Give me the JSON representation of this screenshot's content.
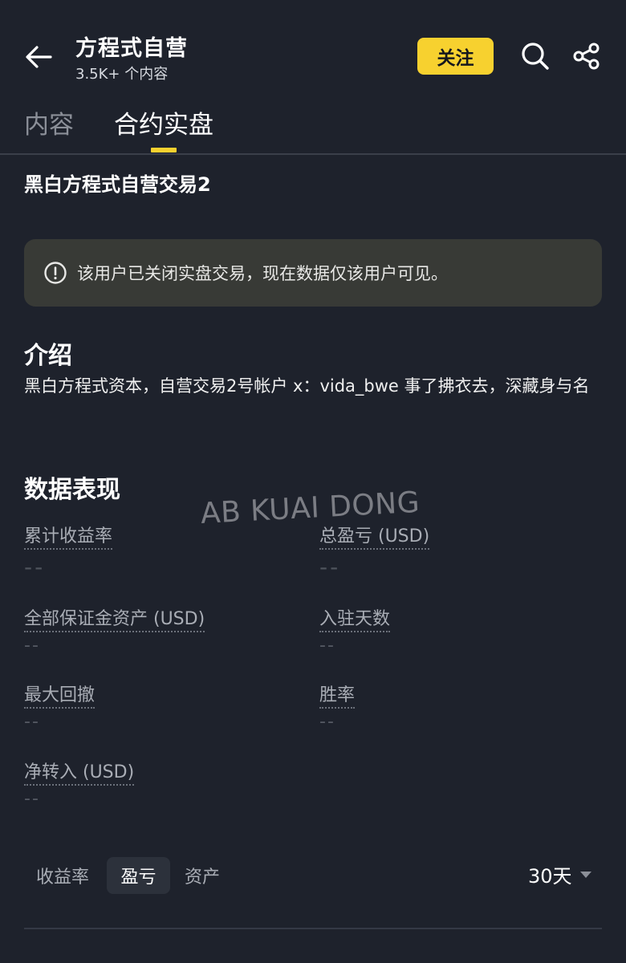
{
  "header": {
    "title": "方程式自营",
    "subtitle": "3.5K+ 个内容",
    "follow_label": "关注"
  },
  "tabs": [
    {
      "label": "内容",
      "active": false
    },
    {
      "label": "合约实盘",
      "active": true
    }
  ],
  "account_name": "黑白方程式自营交易2",
  "notice": {
    "text": "该用户已关闭实盘交易，现在数据仅该用户可见。"
  },
  "intro": {
    "heading": "介绍",
    "text": "黑白方程式资本，自营交易2号帐户 x：vida_bwe 事了拂衣去，深藏身与名"
  },
  "performance": {
    "heading": "数据表现",
    "metrics": [
      {
        "label": "累计收益率",
        "value": "--"
      },
      {
        "label": "总盈亏 (USD)",
        "value": "--"
      },
      {
        "label": "全部保证金资产 (USD)",
        "value": "--"
      },
      {
        "label": "入驻天数",
        "value": "--"
      },
      {
        "label": "最大回撤",
        "value": "--"
      },
      {
        "label": "胜率",
        "value": "--"
      },
      {
        "label": "净转入 (USD)",
        "value": "--"
      }
    ]
  },
  "watermark": "AB KUAI DONG",
  "chart_tabs": [
    {
      "label": "收益率",
      "active": false
    },
    {
      "label": "盈亏",
      "active": true
    },
    {
      "label": "资产",
      "active": false
    }
  ],
  "period": "30天",
  "colors": {
    "background": "#1e222c",
    "accent": "#f7d12f",
    "notice_bg": "#383a36"
  }
}
